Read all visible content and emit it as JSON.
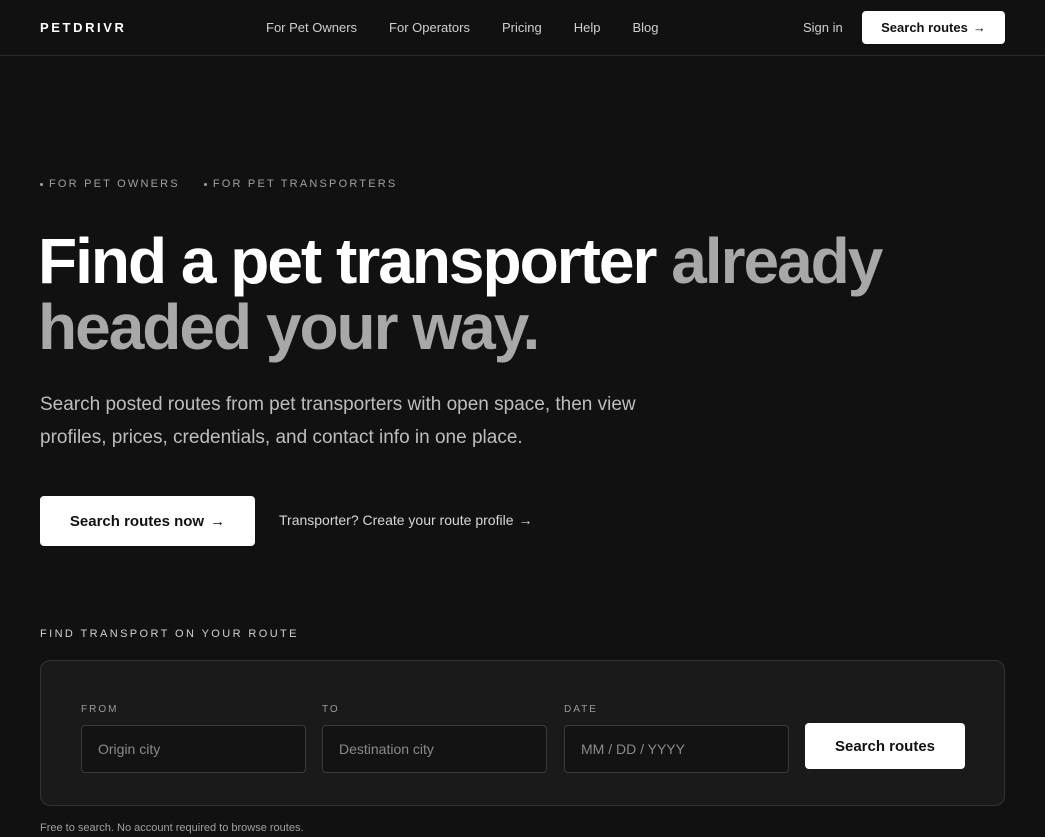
{
  "brand": {
    "logo": "PETDRIVR"
  },
  "nav": {
    "links": [
      "For Pet Owners",
      "For Operators",
      "Pricing",
      "Help",
      "Blog"
    ],
    "sign_in": "Sign in",
    "cta_label": "Search routes",
    "cta_icon": "arrow-right-icon"
  },
  "hero": {
    "eyebrows": [
      "FOR PET OWNERS",
      "FOR PET TRANSPORTERS"
    ],
    "headline_main": "Find a pet transporter",
    "headline_muted": "already headed your way.",
    "subhead": "Search posted routes from pet transporters with open space, then view profiles, prices, credentials, and contact info in one place.",
    "primary_cta": "Search routes now",
    "secondary_cta": "Transporter? Create your route profile"
  },
  "search": {
    "section_label": "FIND TRANSPORT ON YOUR ROUTE",
    "from": {
      "label": "FROM",
      "placeholder": "Origin city",
      "value": ""
    },
    "to": {
      "label": "TO",
      "placeholder": "Destination city",
      "value": ""
    },
    "date": {
      "label": "DATE",
      "placeholder": "MM / DD / YYYY",
      "value": ""
    },
    "button": "Search routes",
    "footnote": "Free to search. No account required to browse routes."
  },
  "colors": {
    "background": "#111111",
    "card": "#1a1a1a",
    "accent": "#ffffff",
    "muted_text": "#a8a8a8"
  }
}
